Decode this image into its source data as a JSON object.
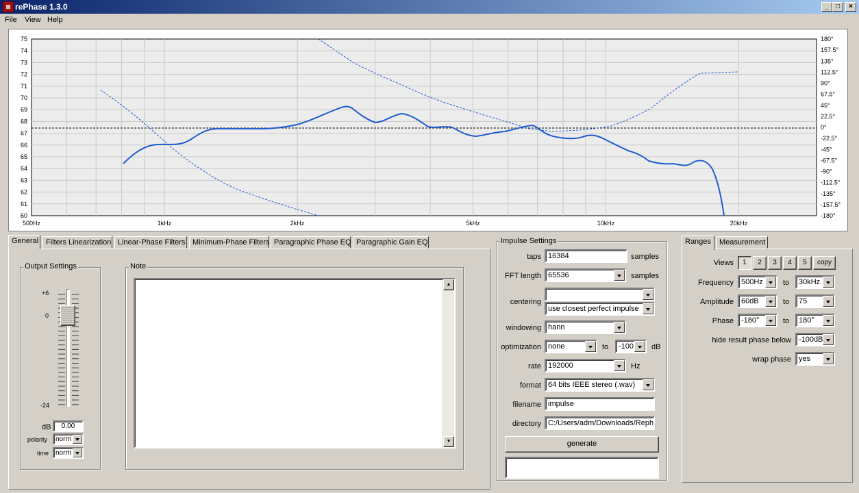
{
  "window": {
    "title": "rePhase 1.3.0",
    "controls": [
      "minimize",
      "maximize",
      "close"
    ]
  },
  "menu": [
    "File",
    "View",
    "Help"
  ],
  "plot": {
    "left_axis_labels": [
      "75",
      "74",
      "73",
      "72",
      "71",
      "70",
      "69",
      "68",
      "67",
      "66",
      "65",
      "64",
      "63",
      "62",
      "61",
      "60"
    ],
    "right_axis_labels": [
      "180°",
      "157.5°",
      "135°",
      "112.5°",
      "90°",
      "67.5°",
      "45°",
      "22.5°",
      "0°",
      "-22.5°",
      "-45°",
      "-67.5°",
      "-90°",
      "-112.5°",
      "-135°",
      "-157.5°",
      "-180°"
    ],
    "freq_labels": [
      "500Hz",
      "1kHz",
      "2kHz",
      "5kHz",
      "10kHz",
      "20kHz"
    ],
    "colors": {
      "curve": "#1e5ccf",
      "grid": "#c8c8c8",
      "background": "#ececec"
    }
  },
  "tabs": {
    "items": [
      "General",
      "Filters Linearization",
      "Linear-Phase Filters",
      "Minimum-Phase Filters",
      "Paragraphic Phase EQ",
      "Paragraphic Gain EQ"
    ],
    "active": "General"
  },
  "output_settings": {
    "title": "Output Settings",
    "fader_top": "+6",
    "fader_zero": "0",
    "fader_bottom": "-24",
    "db_label": "dB",
    "db_value": "0.00",
    "polarity_label": "polarity",
    "polarity_value": "norm",
    "time_label": "time",
    "time_value": "norm"
  },
  "note": {
    "title": "Note",
    "content": ""
  },
  "impulse": {
    "title": "Impulse Settings",
    "taps_label": "taps",
    "taps_value": "16384",
    "taps_unit": "samples",
    "fft_label": "FFT length",
    "fft_value": "65536",
    "fft_unit": "samples",
    "centering_label": "centering",
    "centering_value1": "",
    "centering_value2": "use closest perfect impulse",
    "windowing_label": "windowing",
    "windowing_value": "hann",
    "optimization_label": "optimization",
    "optimization_value": "none",
    "optimization_to": "to",
    "optimization_db": "-100",
    "optimization_unit": "dB",
    "rate_label": "rate",
    "rate_value": "192000",
    "rate_unit": "Hz",
    "format_label": "format",
    "format_value": "64 bits IEEE stereo (.wav)",
    "filename_label": "filename",
    "filename_value": "impulse",
    "directory_label": "directory",
    "directory_value": "C:/Users/adm/Downloads/Repha",
    "generate_label": "generate",
    "status": ""
  },
  "ranges": {
    "tabs": [
      "Ranges",
      "Measurement"
    ],
    "active_tab": "Ranges",
    "views_label": "Views",
    "views": [
      "1",
      "2",
      "3",
      "4",
      "5"
    ],
    "views_active": "1",
    "copy_label": "copy",
    "frequency_label": "Frequency",
    "frequency_from": "500Hz",
    "frequency_to": "30kHz",
    "amplitude_label": "Amplitude",
    "amplitude_from": "60dB",
    "amplitude_to": "75",
    "phase_label": "Phase",
    "phase_from": "-180°",
    "phase_to": "180°",
    "to_label": "to",
    "hide_label": "hide result phase below",
    "hide_value": "-100dB",
    "wrap_label": "wrap phase",
    "wrap_value": "yes"
  }
}
